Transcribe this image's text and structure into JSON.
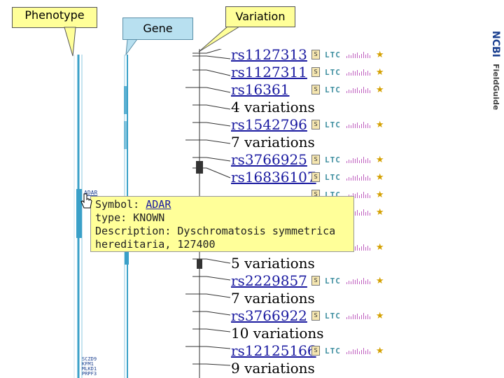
{
  "callouts": {
    "phenotype": "Phenotype",
    "gene": "Gene",
    "variation": "Variation"
  },
  "brand": {
    "name": "NCBI",
    "product": "FieldGuide"
  },
  "tracks": {
    "adar_label": "ADAR",
    "bottom_labels": [
      "SCZD9",
      "KFM1",
      "MLKD1",
      "PRPF3"
    ]
  },
  "tooltip": {
    "symbol_label": "Symbol:",
    "symbol_value": "ADAR",
    "type_line": "type: KNOWN",
    "desc_line1": "Description: Dyschromatosis symmetrica",
    "desc_line2": "hereditaria, 127400"
  },
  "variations": [
    {
      "text": "rs1127313",
      "link": true,
      "icons": true
    },
    {
      "text": "rs1127311",
      "link": true,
      "icons": true
    },
    {
      "text": "rs16361",
      "link": true,
      "icons": true
    },
    {
      "text": "4 variations",
      "link": false,
      "icons": false
    },
    {
      "text": "rs1542796",
      "link": true,
      "icons": true
    },
    {
      "text": "7 variations",
      "link": false,
      "icons": false
    },
    {
      "text": "rs3766925",
      "link": true,
      "icons": true
    },
    {
      "text": "rs16836107",
      "link": true,
      "icons": true
    },
    {
      "text": "",
      "link": false,
      "icons": true
    },
    {
      "text": "",
      "link": false,
      "icons": true
    },
    {
      "text": "",
      "link": false,
      "icons": false
    },
    {
      "text": "",
      "link": true,
      "icons": true
    },
    {
      "text": "5 variations",
      "link": false,
      "icons": false
    },
    {
      "text": "rs2229857",
      "link": true,
      "icons": true
    },
    {
      "text": "7 variations",
      "link": false,
      "icons": false
    },
    {
      "text": "rs3766922",
      "link": true,
      "icons": true
    },
    {
      "text": "10 variations",
      "link": false,
      "icons": false
    },
    {
      "text": "rs12125166",
      "link": true,
      "icons": true
    },
    {
      "text": "9 variations",
      "link": false,
      "icons": false
    }
  ],
  "icon_set": {
    "snp_icon": "S",
    "ltc_icon": "LTC",
    "bar_icon": "bar-graph-icon",
    "star_icon": "★"
  },
  "colors": {
    "callout_bg": "#ffff99",
    "link": "#1a1aa0",
    "track": "#3aa0c8",
    "ltc": "#3f8fa0",
    "bars": "#c060c0",
    "star": "#d4a000"
  }
}
